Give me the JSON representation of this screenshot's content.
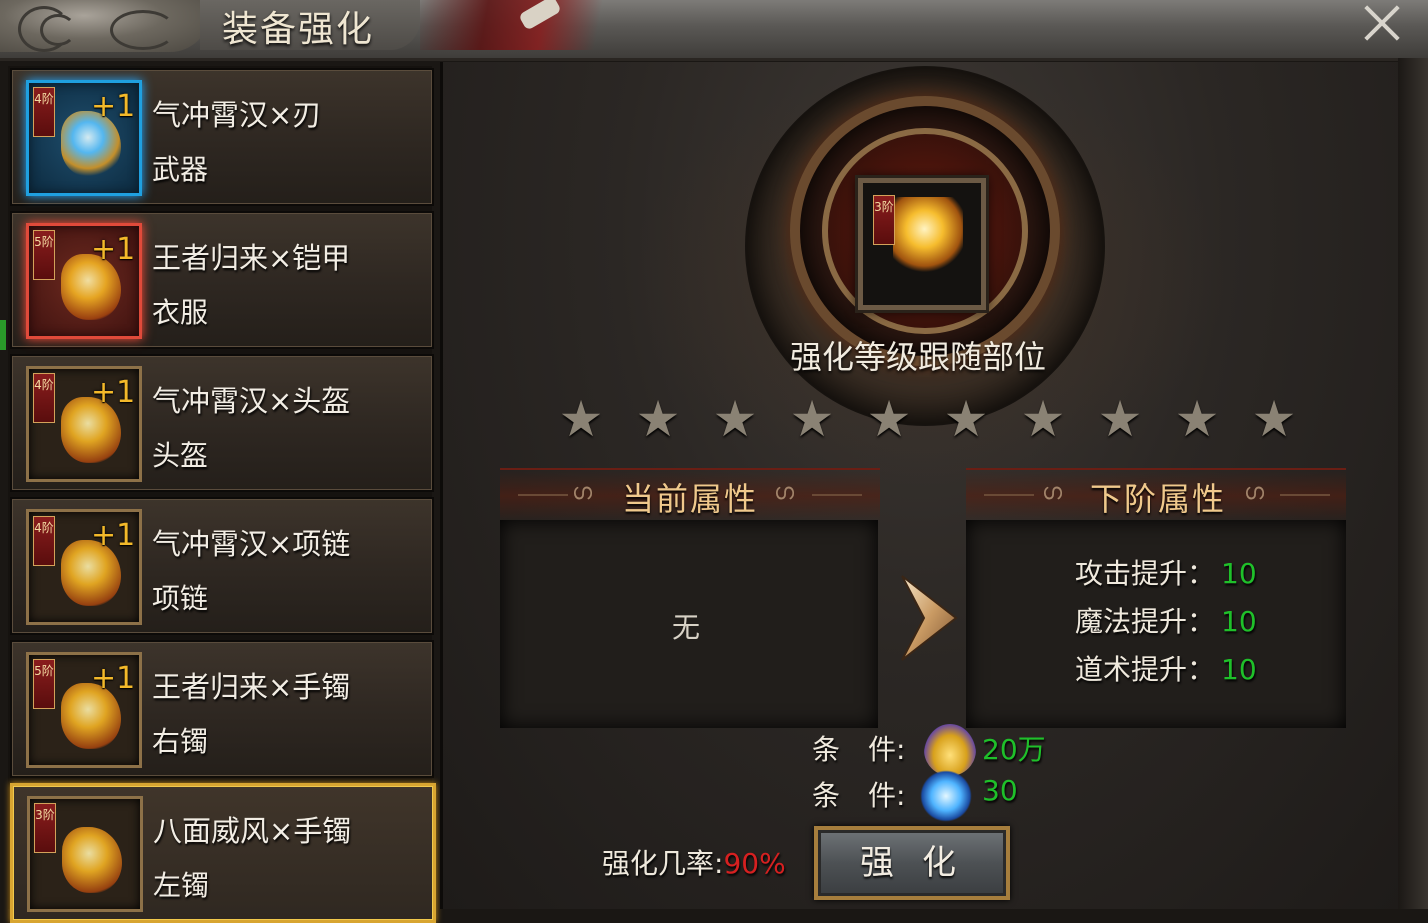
{
  "window": {
    "title": "装备强化"
  },
  "equipment_list": [
    {
      "name": "气冲霄汉×刃",
      "slot": "武器",
      "grade": "4阶",
      "plus": "+1",
      "frame": "blue"
    },
    {
      "name": "王者归来×铠甲",
      "slot": "衣服",
      "grade": "5阶",
      "plus": "+1",
      "frame": "red"
    },
    {
      "name": "气冲霄汉×头盔",
      "slot": "头盔",
      "grade": "4阶",
      "plus": "+1",
      "frame": "gold"
    },
    {
      "name": "气冲霄汉×项链",
      "slot": "项链",
      "grade": "4阶",
      "plus": "+1",
      "frame": "gold"
    },
    {
      "name": "王者归来×手镯",
      "slot": "右镯",
      "grade": "5阶",
      "plus": "+1",
      "frame": "gold"
    },
    {
      "name": "八面威风×手镯",
      "slot": "左镯",
      "grade": "3阶",
      "plus": "",
      "frame": "gold",
      "selected": true
    }
  ],
  "center": {
    "grade": "3阶",
    "caption": "强化等级跟随部位",
    "stars_filled": 0,
    "stars_total": 10
  },
  "current_attributes": {
    "title": "当前属性",
    "empty_text": "无"
  },
  "next_attributes": {
    "title": "下阶属性",
    "stats": [
      {
        "label": "攻击提升：",
        "value": "10"
      },
      {
        "label": "魔法提升：",
        "value": "10"
      },
      {
        "label": "道术提升：",
        "value": "10"
      }
    ]
  },
  "conditions": [
    {
      "label": "条　件:",
      "icon": "gold-ingot-icon",
      "value": "20万"
    },
    {
      "label": "条　件:",
      "icon": "blue-crystal-icon",
      "value": "30"
    }
  ],
  "rate": {
    "label": "强化几率:",
    "value": "90%"
  },
  "enhance_button": {
    "label": "强化"
  },
  "colors": {
    "value_green": "#1fc02a",
    "rate_red": "#d62020",
    "selected_gold": "#d8a531"
  }
}
